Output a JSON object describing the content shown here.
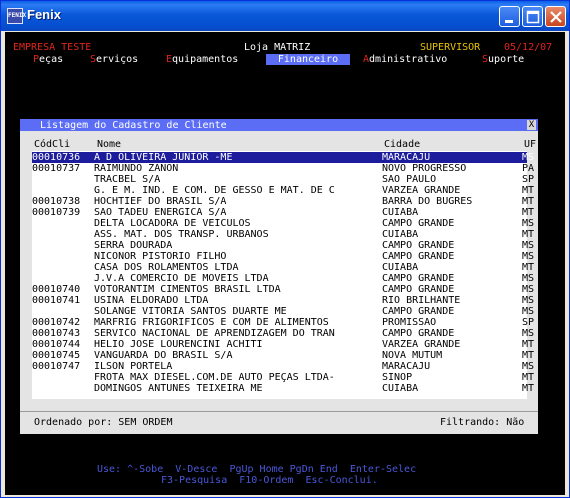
{
  "window": {
    "title": "Fenix",
    "icon_label": "FENIX"
  },
  "status": {
    "company": "EMPRESA TESTE",
    "store": "Loja MATRIZ",
    "user": "SUPERVISOR",
    "date": "05/12/07"
  },
  "menu": [
    {
      "hot": "P",
      "rest": "eças"
    },
    {
      "hot": "S",
      "rest": "erviços"
    },
    {
      "hot": "E",
      "rest": "quipamentos"
    },
    {
      "hot": "",
      "rest": "Financeiro"
    },
    {
      "hot": "A",
      "rest": "dministrativo"
    },
    {
      "hot": "S",
      "rest": "uporte"
    }
  ],
  "dialog": {
    "title": "Listagem do Cadastro de Cliente",
    "close": "X",
    "columns": {
      "code": "CódCli",
      "name": "Nome",
      "city": "Cidade",
      "uf": "UF"
    },
    "rows": [
      {
        "code": "00010736",
        "name": "A D OLIVEIRA JUNIOR -ME",
        "city": "MARACAJU",
        "uf": "MS"
      },
      {
        "code": "00010737",
        "name": "RAIMUNDO ZANON",
        "city": "NOVO PROGRESSO",
        "uf": "PA"
      },
      {
        "code": "",
        "name": "TRACBEL S/A",
        "city": "SAO PAULO",
        "uf": "SP"
      },
      {
        "code": "",
        "name": "G. E M. IND. E COM. DE GESSO E MAT. DE C",
        "city": "VARZEA GRANDE",
        "uf": "MT"
      },
      {
        "code": "00010738",
        "name": "HOCHTIEF DO BRASIL S/A",
        "city": "BARRA DO BUGRES",
        "uf": "MT"
      },
      {
        "code": "00010739",
        "name": "SAO TADEU ENERGICA S/A",
        "city": "CUIABA",
        "uf": "MT"
      },
      {
        "code": "",
        "name": "DELTA LOCADORA DE VEICULOS",
        "city": "CAMPO GRANDE",
        "uf": "MS"
      },
      {
        "code": "",
        "name": "ASS. MAT. DOS TRANSP. URBANOS",
        "city": "CUIABA",
        "uf": "MT"
      },
      {
        "code": "",
        "name": "SERRA DOURADA",
        "city": "CAMPO GRANDE",
        "uf": "MS"
      },
      {
        "code": "",
        "name": "NICONOR PISTORIO FILHO",
        "city": "CAMPO GRANDE",
        "uf": "MS"
      },
      {
        "code": "",
        "name": "CASA DOS ROLAMENTOS LTDA",
        "city": "CUIABA",
        "uf": "MT"
      },
      {
        "code": "",
        "name": "J.V.A COMERCIO DE MOVEIS LTDA",
        "city": "CAMPO GRANDE",
        "uf": "MS"
      },
      {
        "code": "00010740",
        "name": "VOTORANTIM CIMENTOS BRASIL LTDA",
        "city": "CAMPO GRANDE",
        "uf": "MS"
      },
      {
        "code": "00010741",
        "name": "USINA ELDORADO LTDA",
        "city": "RIO BRILHANTE",
        "uf": "MS"
      },
      {
        "code": "",
        "name": "SOLANGE VITORIA SANTOS DUARTE ME",
        "city": "CAMPO GRANDE",
        "uf": "MS"
      },
      {
        "code": "00010742",
        "name": "MARFRIG FRIGORIFICOS E COM DE ALIMENTOS",
        "city": "PROMISSAO",
        "uf": "SP"
      },
      {
        "code": "00010743",
        "name": "SERVICO NACIONAL DE APRENDIZAGEM DO TRAN",
        "city": "CAMPO GRANDE",
        "uf": "MS"
      },
      {
        "code": "00010744",
        "name": "HELIO JOSE LOURENCINI ACHITI",
        "city": "VARZEA GRANDE",
        "uf": "MT"
      },
      {
        "code": "00010745",
        "name": "VANGUARDA DO BRASIL S/A",
        "city": "NOVA MUTUM",
        "uf": "MT"
      },
      {
        "code": "00010747",
        "name": "ILSON PORTELA",
        "city": "MARACAJU",
        "uf": "MS"
      },
      {
        "code": "",
        "name": "FROTA MAX DIESEL.COM.DE AUTO PEÇAS LTDA-",
        "city": "SINOP",
        "uf": "MT"
      },
      {
        "code": "",
        "name": "DOMINGOS ANTUNES TEIXEIRA ME",
        "city": "CUIABA",
        "uf": "MT"
      }
    ],
    "footer": {
      "sort": "Ordenado por: SEM ORDEM",
      "filter": "Filtrando: Não"
    }
  },
  "help": {
    "line1": "Use: ^-Sobe  V-Desce  PgUp Home PgDn End  Enter-Selec",
    "line2": "F3-Pesquisa  F10-Ordem  Esc-Conclui."
  },
  "colors": {
    "status_red": "#e0251c",
    "status_yellow": "#e8c200",
    "menu_hot": "#e0251c",
    "menu_text": "#ffffff",
    "menu_highlight": "#5b6cf5",
    "help_text": "#4a58d8",
    "selected_row": "#1c1c9c"
  }
}
